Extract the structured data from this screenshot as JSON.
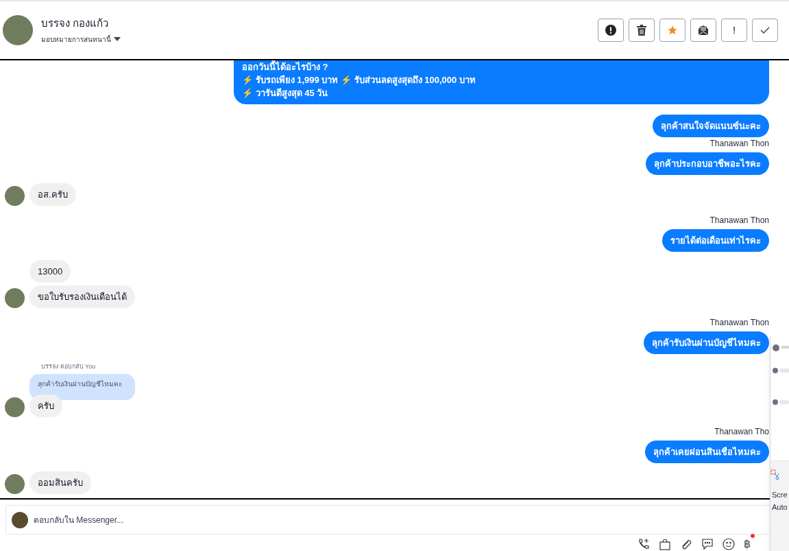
{
  "header": {
    "name": "บรรจง กองแก้ว",
    "assign": "มอบหมายการสนทนานี้",
    "actions": [
      {
        "kind": "alert"
      },
      {
        "kind": "trash"
      },
      {
        "kind": "star"
      },
      {
        "kind": "mail"
      },
      {
        "kind": "exclaim",
        "label": "!"
      },
      {
        "kind": "check"
      }
    ]
  },
  "messages": [
    {
      "kind": "out",
      "lines": [
        "ออกวันนี้ได้อะไรบ้าง ?",
        "⚡ รับรถเพียง 1,999 บาท ⚡ รับส่วนลดสูงสุดถึง 100,000 บาท",
        "⚡ วารันตีสูงสุด 45 วัน"
      ]
    },
    {
      "kind": "out",
      "lines": [
        "ลุกค้าสนใจจัดแนนซ์นะคะ"
      ]
    },
    {
      "kind": "sender",
      "text": "Thanawan Thon"
    },
    {
      "kind": "out",
      "lines": [
        "ลุกค้าประกอบอาชีพอะไรคะ"
      ]
    },
    {
      "kind": "in",
      "lines": [
        "อส.ครับ"
      ],
      "avatar": true
    },
    {
      "kind": "sender",
      "text": "Thanawan Thon"
    },
    {
      "kind": "out",
      "lines": [
        "รายได้ต่อเดือนเท่าไรคะ"
      ]
    },
    {
      "kind": "in",
      "lines": [
        "13000"
      ],
      "avatar": false
    },
    {
      "kind": "in",
      "lines": [
        "ขอใบรับรองเงินเดือนได้"
      ],
      "avatar": true
    },
    {
      "kind": "sender",
      "text": "Thanawan Thon"
    },
    {
      "kind": "out",
      "lines": [
        "ลุกค้ารับเงินผ่านบัญชีไหมคะ"
      ]
    },
    {
      "kind": "reply",
      "label": "บรรจง ตอบกลับ You",
      "quote": "ลุกค้ารับเงินผ่านบัญชีไหมคะ",
      "lines": [
        "ครับ"
      ]
    },
    {
      "kind": "sender",
      "text": "Thanawan Tho"
    },
    {
      "kind": "out",
      "lines": [
        "ลุกค้าเคยผ่อนสินเชือไหมคะ"
      ]
    },
    {
      "kind": "in",
      "lines": [
        "ออมสินครับ"
      ],
      "avatar": true
    }
  ],
  "composer": {
    "placeholder": "ตอบกลับใน Messenger...",
    "tools": [
      {
        "kind": "call"
      },
      {
        "kind": "bag"
      },
      {
        "kind": "clip"
      },
      {
        "kind": "chat"
      },
      {
        "kind": "smile"
      },
      {
        "kind": "baht",
        "label": "฿"
      }
    ]
  },
  "notification": {
    "lines": [
      "Scre",
      "Auto"
    ]
  }
}
